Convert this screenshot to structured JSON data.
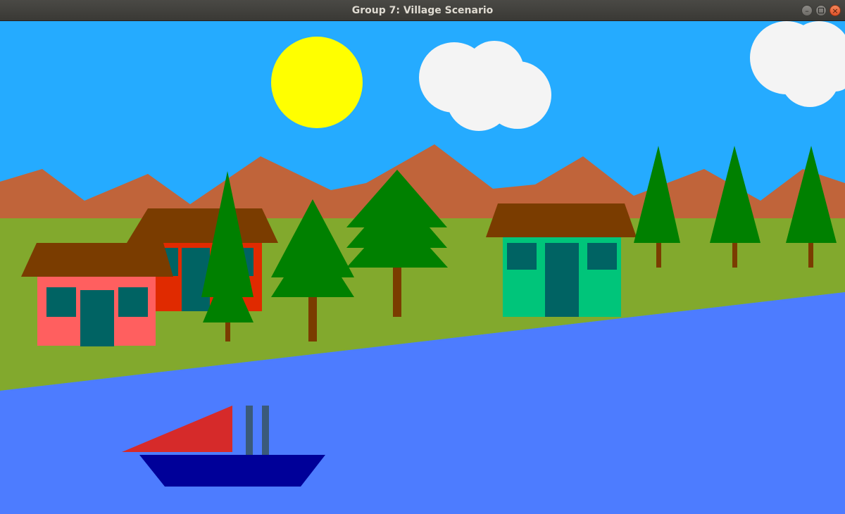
{
  "window": {
    "title": "Group 7: Village Scenario",
    "controls": {
      "minimize_icon": "minimize-icon",
      "maximize_icon": "maximize-icon",
      "close_icon": "close-icon"
    }
  },
  "scene": {
    "colors": {
      "sky": "#25abff",
      "sun": "#ffff00",
      "cloud": "#f4f4f4",
      "mountain": "#c0643a",
      "grass": "#82a92d",
      "water": "#4d7cff",
      "roof": "#7a3c00",
      "house_pink": "#ff5f5f",
      "house_red": "#e02a00",
      "house_teal": "#00c57a",
      "window_door": "#006363",
      "tree": "#008000",
      "trunk": "#7a3c00",
      "sail": "#d62a2a",
      "hull": "#000099",
      "mast": "#3a5a7a"
    }
  }
}
